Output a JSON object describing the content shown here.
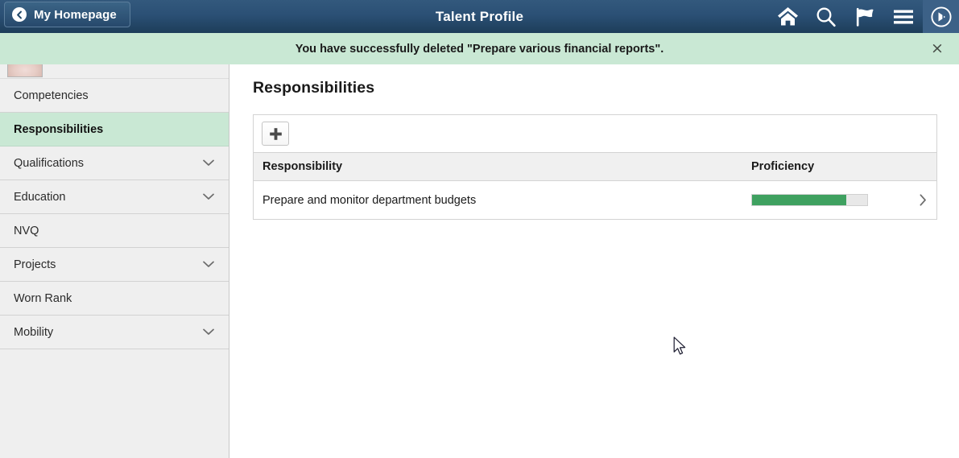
{
  "header": {
    "back_label": "My Homepage",
    "title": "Talent Profile",
    "icons": [
      {
        "name": "home-icon",
        "label": "Home"
      },
      {
        "name": "search-icon",
        "label": "Search"
      },
      {
        "name": "flag-icon",
        "label": "Notifications"
      },
      {
        "name": "hamburger-menu-icon",
        "label": "Actions"
      },
      {
        "name": "navigator-compass-icon",
        "label": "NavBar"
      }
    ],
    "colors": {
      "gradient_top": "#33597d",
      "gradient_bottom": "#1d3d59",
      "navbar_button_bg": "#3c6187"
    }
  },
  "notification": {
    "message": "You have successfully deleted \"Prepare various financial reports\".",
    "close_label": "×",
    "background": "#c9e8d4"
  },
  "sidebar": {
    "avatar_alt": "Employee photo",
    "items": [
      {
        "label": "Competencies",
        "expandable": false,
        "active": false
      },
      {
        "label": "Responsibilities",
        "expandable": false,
        "active": true
      },
      {
        "label": "Qualifications",
        "expandable": true,
        "active": false
      },
      {
        "label": "Education",
        "expandable": true,
        "active": false
      },
      {
        "label": "NVQ",
        "expandable": false,
        "active": false
      },
      {
        "label": "Projects",
        "expandable": true,
        "active": false
      },
      {
        "label": "Worn Rank",
        "expandable": false,
        "active": false
      },
      {
        "label": "Mobility",
        "expandable": true,
        "active": false
      }
    ],
    "active_background": "#c9e8d4"
  },
  "main": {
    "page_title": "Responsibilities",
    "toolbar": {
      "add_label": "+"
    },
    "grid": {
      "columns": [
        "Responsibility",
        "Proficiency"
      ],
      "rows": [
        {
          "responsibility": "Prepare and monitor department budgets",
          "proficiency_percent": 82,
          "proficiency_color": "#3fa160"
        }
      ]
    }
  }
}
